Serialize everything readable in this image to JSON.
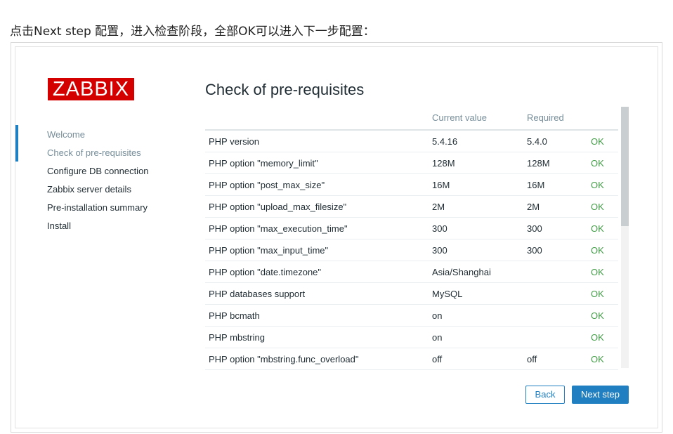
{
  "caption": "点击Next step 配置，进入检查阶段，全部OK可以进入下一步配置：",
  "logo": {
    "text": "ZABBIX"
  },
  "nav": {
    "items": [
      {
        "label": "Welcome"
      },
      {
        "label": "Check of pre-requisites"
      },
      {
        "label": "Configure DB connection"
      },
      {
        "label": "Zabbix server details"
      },
      {
        "label": "Pre-installation summary"
      },
      {
        "label": "Install"
      }
    ]
  },
  "page": {
    "title": "Check of pre-requisites"
  },
  "table": {
    "columns": {
      "current": "Current value",
      "required": "Required"
    },
    "rows": [
      {
        "name": "PHP version",
        "current": "5.4.16",
        "required": "5.4.0",
        "status": "OK"
      },
      {
        "name": "PHP option \"memory_limit\"",
        "current": "128M",
        "required": "128M",
        "status": "OK"
      },
      {
        "name": "PHP option \"post_max_size\"",
        "current": "16M",
        "required": "16M",
        "status": "OK"
      },
      {
        "name": "PHP option \"upload_max_filesize\"",
        "current": "2M",
        "required": "2M",
        "status": "OK"
      },
      {
        "name": "PHP option \"max_execution_time\"",
        "current": "300",
        "required": "300",
        "status": "OK"
      },
      {
        "name": "PHP option \"max_input_time\"",
        "current": "300",
        "required": "300",
        "status": "OK"
      },
      {
        "name": "PHP option \"date.timezone\"",
        "current": "Asia/Shanghai",
        "required": "",
        "status": "OK"
      },
      {
        "name": "PHP databases support",
        "current": "MySQL",
        "required": "",
        "status": "OK"
      },
      {
        "name": "PHP bcmath",
        "current": "on",
        "required": "",
        "status": "OK"
      },
      {
        "name": "PHP mbstring",
        "current": "on",
        "required": "",
        "status": "OK"
      },
      {
        "name": "PHP option \"mbstring.func_overload\"",
        "current": "off",
        "required": "off",
        "status": "OK"
      }
    ]
  },
  "buttons": {
    "back": "Back",
    "next": "Next step"
  },
  "colors": {
    "brand": "#d40000",
    "accent": "#1f7fc1",
    "ok": "#429e47"
  }
}
